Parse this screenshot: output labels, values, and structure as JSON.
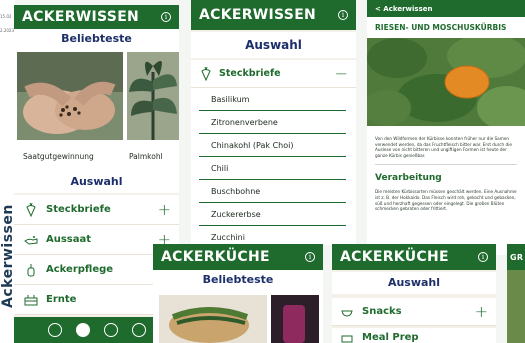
{
  "side": {
    "date1": "15.02",
    "date2": "2.2023",
    "vertical_text": "Ackerwissen"
  },
  "p1": {
    "title": "ACKERWISSEN",
    "beliebteste": "Beliebteste",
    "tiles": [
      "Saatgutgewinnung",
      "Palmkohl"
    ],
    "auswahl": "Auswahl",
    "items": [
      {
        "label": "Steckbriefe",
        "icon": "carrot-icon",
        "action": "+"
      },
      {
        "label": "Aussaat",
        "icon": "seed-hand-icon",
        "action": "+"
      },
      {
        "label": "Ackerpflege",
        "icon": "watering-icon",
        "action": "+"
      },
      {
        "label": "Ernte",
        "icon": "crate-icon",
        "action": ""
      }
    ],
    "nav": [
      "carrot-tab-icon",
      "book-tab-icon",
      "kitchen-tab-icon",
      "calendar-tab-icon"
    ]
  },
  "p2": {
    "title": "ACKERWISSEN",
    "auswahl": "Auswahl",
    "section": "Steckbriefe",
    "section_action": "−",
    "subitems": [
      "Basilikum",
      "Zitronenverbene",
      "Chinakohl (Pak Choi)",
      "Chili",
      "Buschbohne",
      "Zuckererbse",
      "Zucchini"
    ]
  },
  "p3": {
    "back": "< Ackerwissen",
    "title": "RIESEN- UND MOSCHUSKÜRBIS",
    "body": "Von den Wildformen der Kürbisse konnten früher nur die Samen verwendet werden, da das Fruchtfleisch bitter war. Erst durch die Auslese von nicht bitteren und ungiftigen Formen ist heute der ganze Kürbis genießbar.",
    "heading": "Verarbeitung",
    "body2": "Die meisten Kürbissorten müssen geschält werden. Eine Ausnahme ist z. B. der Hokkaido. Das Fleisch wird roh, gekocht und gebacken, süß und herzhaft gegessen oder eingelegt. Die großen Blüten schmecken gebraten oder frittiert."
  },
  "p4": {
    "title": "ACKERKÜCHE",
    "beliebteste": "Beliebteste"
  },
  "p5": {
    "title": "ACKERKÜCHE",
    "auswahl": "Auswahl",
    "items": [
      "Snacks",
      "Meal Prep"
    ],
    "action": "+"
  },
  "p6": {
    "title": "GR"
  }
}
